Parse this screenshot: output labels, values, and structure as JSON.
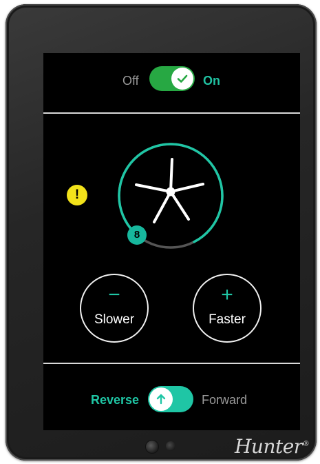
{
  "power": {
    "off_label": "Off",
    "on_label": "On",
    "state": "on"
  },
  "status": {
    "warning_symbol": "!"
  },
  "fan": {
    "speed": "8",
    "speed_fraction": 0.8,
    "icon": "fan-blades-icon"
  },
  "controls": {
    "slower_symbol": "−",
    "slower_label": "Slower",
    "faster_symbol": "+",
    "faster_label": "Faster"
  },
  "direction": {
    "reverse_label": "Reverse",
    "forward_label": "Forward",
    "state": "reverse"
  },
  "brand": {
    "name": "Hunter",
    "mark": "®"
  },
  "colors": {
    "accent": "#1fc6a5",
    "power_on": "#27a843",
    "warning": "#f2e21a",
    "screen_bg": "#000000"
  }
}
